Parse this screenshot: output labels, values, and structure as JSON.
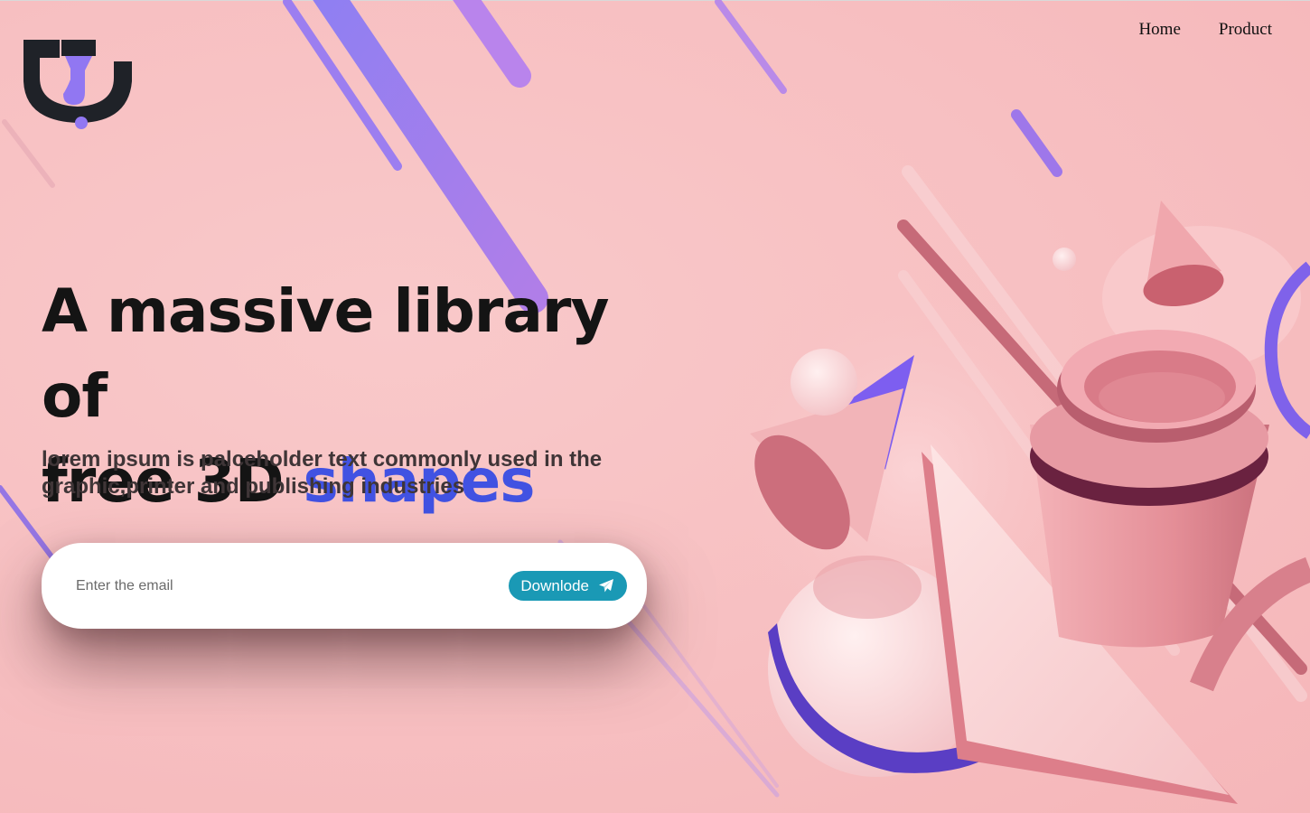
{
  "nav": {
    "home": "Home",
    "product": "Product"
  },
  "hero": {
    "title_part1": "A massive library of",
    "title_part2": "free 3D",
    "title_accent": "shapes",
    "subtitle": "lorem ipsum is palceholder text commonly used in the graphic,printer and publishing industries"
  },
  "signup": {
    "placeholder": "Enter the email",
    "button_label": "Downlode",
    "button_icon": "paper-plane-icon"
  },
  "colors": {
    "background": "#f8c2c4",
    "accent": "#4152e2",
    "button": "#1a99b5",
    "purple": "#9a7cf0",
    "logo_dark": "#1f2228"
  }
}
